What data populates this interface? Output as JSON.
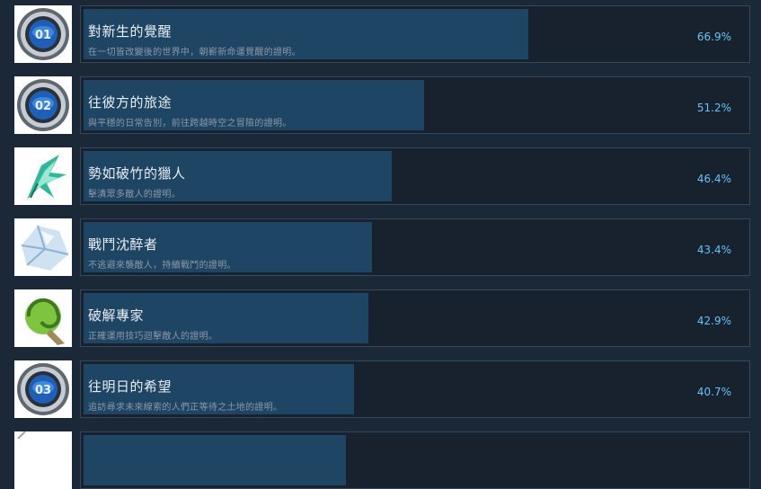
{
  "achievements": [
    {
      "title": "對新生的覺醒",
      "description": "在一切皆改變後的世界中，朝嶄新命運覺醒的證明。",
      "percent_label": "66.9%",
      "percent": 66.9,
      "icon": "medal-01-icon"
    },
    {
      "title": "往彼方的旅途",
      "description": "與平穩的日常告別，前往跨越時空之冒險的證明。",
      "percent_label": "51.2%",
      "percent": 51.2,
      "icon": "medal-02-icon"
    },
    {
      "title": "勢如破竹的獵人",
      "description": "擊潰眾多敵人的證明。",
      "percent_label": "46.4%",
      "percent": 46.4,
      "icon": "green-dragon-icon"
    },
    {
      "title": "戰鬥沈醉者",
      "description": "不逃避來襲敵人，持續戰鬥的證明。",
      "percent_label": "43.4%",
      "percent": 43.4,
      "icon": "ice-crystal-icon"
    },
    {
      "title": "破解專家",
      "description": "正確運用技巧迴擊敵人的證明。",
      "percent_label": "42.9%",
      "percent": 42.9,
      "icon": "green-vortex-icon"
    },
    {
      "title": "往明日的希望",
      "description": "追訪尋求未來線索的人們正等待之土地的證明。",
      "percent_label": "40.7%",
      "percent": 40.7,
      "icon": "medal-03-icon"
    },
    {
      "title": "",
      "description": "",
      "percent_label": "",
      "percent": 39.5,
      "icon": "partial-icon"
    }
  ]
}
